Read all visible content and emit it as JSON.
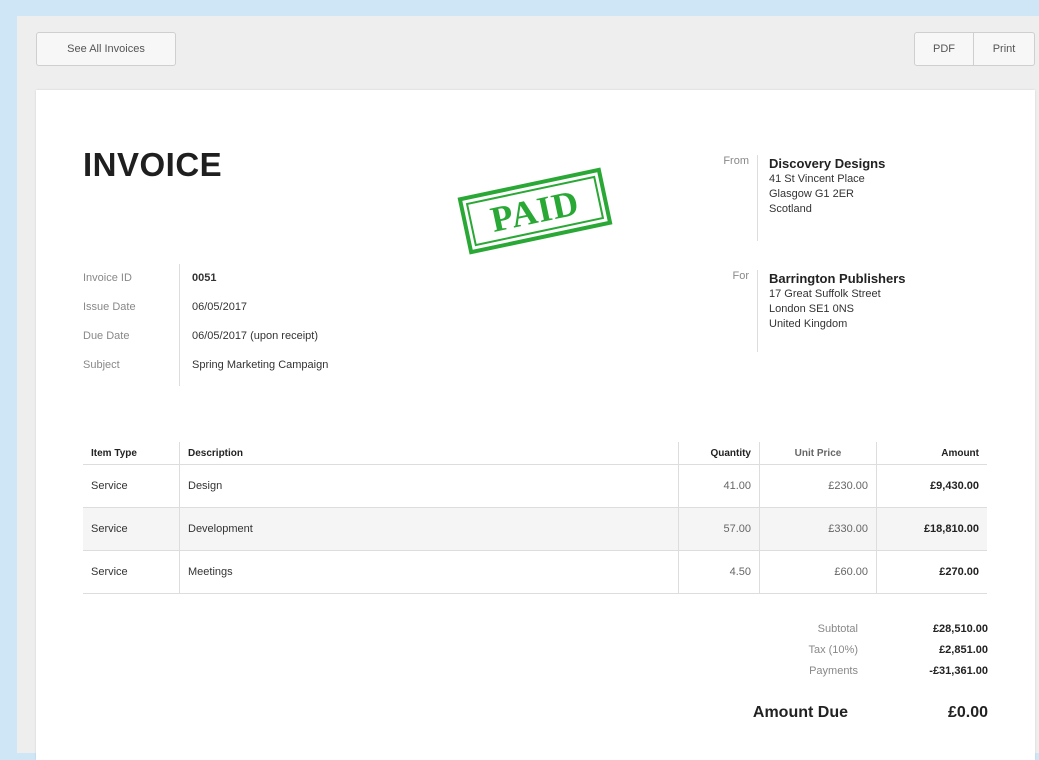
{
  "toolbar": {
    "see_all_label": "See All Invoices",
    "pdf_label": "PDF",
    "print_label": "Print"
  },
  "invoice": {
    "title": "INVOICE",
    "stamp": "PAID",
    "from": {
      "label": "From",
      "name": "Discovery Designs",
      "lines": [
        "41 St Vincent Place",
        "Glasgow G1 2ER",
        "Scotland"
      ]
    },
    "for": {
      "label": "For",
      "name": "Barrington Publishers",
      "lines": [
        "17 Great Suffolk Street",
        "London SE1 0NS",
        "United Kingdom"
      ]
    },
    "meta": [
      {
        "key": "Invoice ID",
        "value": "0051"
      },
      {
        "key": "Issue Date",
        "value": "06/05/2017"
      },
      {
        "key": "Due Date",
        "value": "06/05/2017 (upon receipt)"
      },
      {
        "key": "Subject",
        "value": "Spring Marketing Campaign"
      }
    ],
    "table": {
      "headers": [
        "Item Type",
        "Description",
        "Quantity",
        "Unit Price",
        "Amount"
      ],
      "rows": [
        [
          "Service",
          "Design",
          "41.00",
          "£230.00",
          "£9,430.00"
        ],
        [
          "Service",
          "Development",
          "57.00",
          "£330.00",
          "£18,810.00"
        ],
        [
          "Service",
          "Meetings",
          "4.50",
          "£60.00",
          "£270.00"
        ]
      ]
    },
    "totals": [
      {
        "label": "Subtotal",
        "value": "£28,510.00"
      },
      {
        "label": "Tax (10%)",
        "value": "£2,851.00"
      },
      {
        "label": "Payments",
        "value": "-£31,361.00"
      }
    ],
    "amount_due": {
      "label": "Amount Due",
      "value": "£0.00"
    }
  },
  "colors": {
    "background": "#cfe6f7",
    "stamp": "#2aa835"
  }
}
